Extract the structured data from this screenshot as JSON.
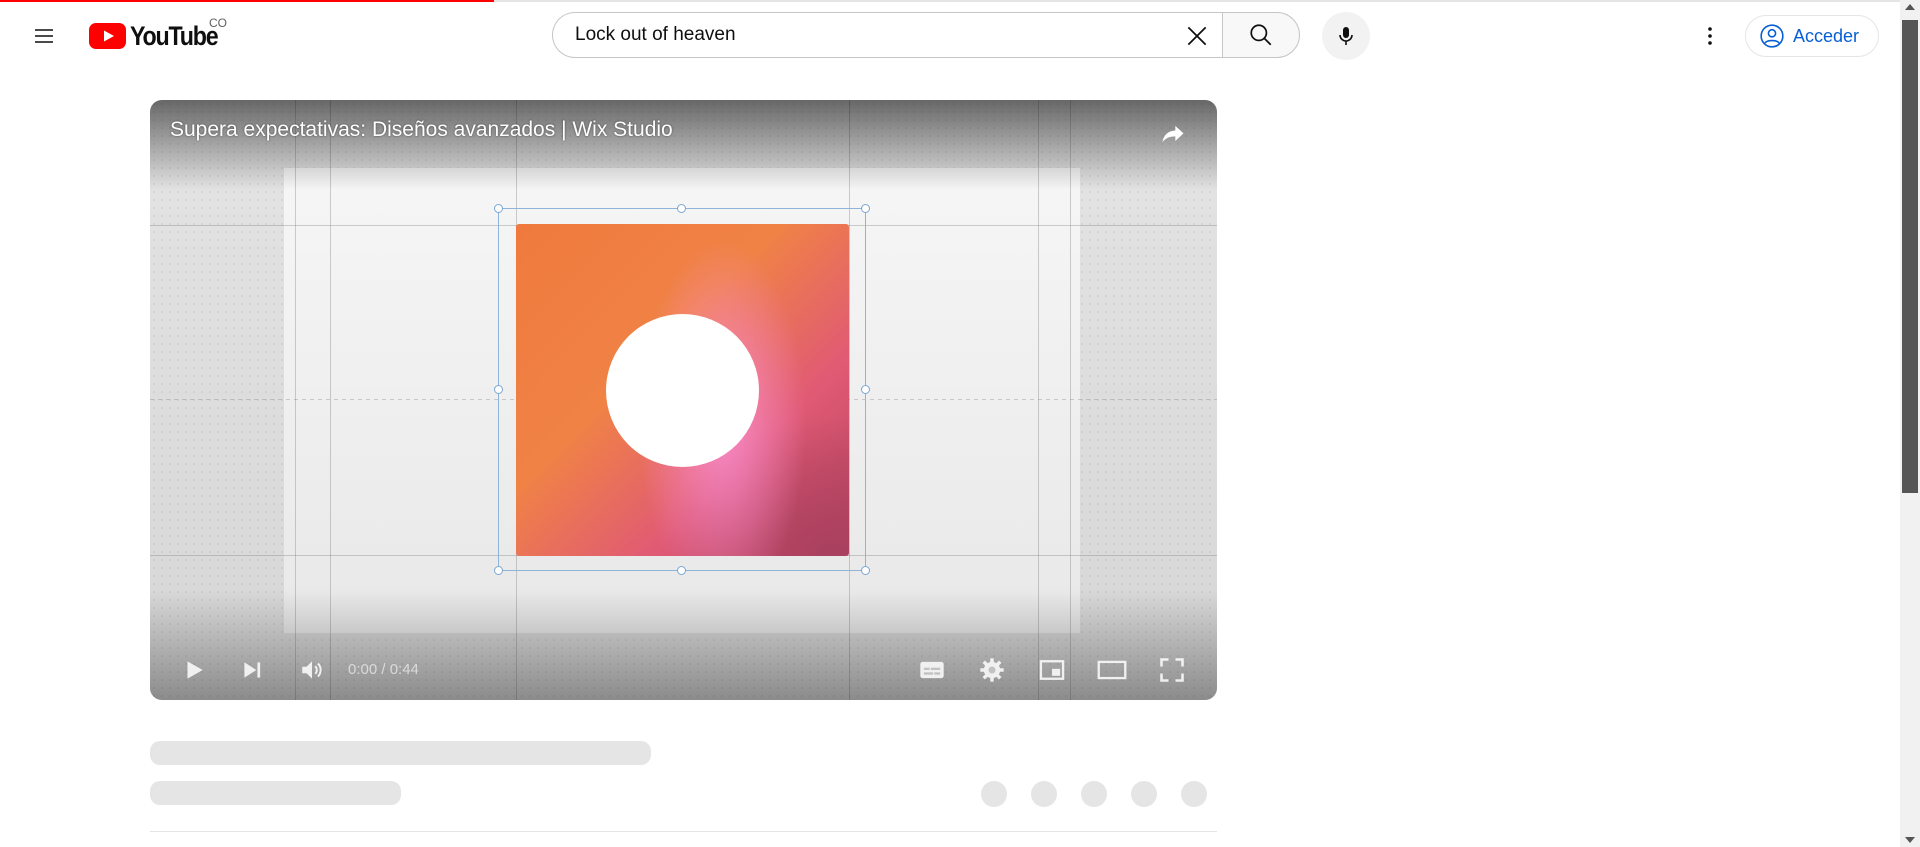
{
  "masthead": {
    "logo_text": "YouTube",
    "country_code": "CO",
    "search": {
      "value": "Lock out of heaven"
    },
    "signin_label": "Acceder"
  },
  "loading_progress_percent": 26,
  "player": {
    "title": "Supera expectativas: Diseños avanzados | Wix Studio",
    "time": "0:00 / 0:44"
  },
  "colors": {
    "brand_red": "#ff0000",
    "link_blue": "#065fd4",
    "art_orange": "#f07a3d",
    "art_pink": "#e05a74"
  },
  "icons": [
    "menu-icon",
    "youtube-logo-icon",
    "clear-icon",
    "search-icon",
    "mic-icon",
    "more-vert-icon",
    "account-circle-icon",
    "share-icon",
    "play-icon",
    "next-icon",
    "volume-icon",
    "subtitles-icon",
    "settings-icon",
    "miniplayer-icon",
    "theater-icon",
    "fullscreen-icon"
  ]
}
